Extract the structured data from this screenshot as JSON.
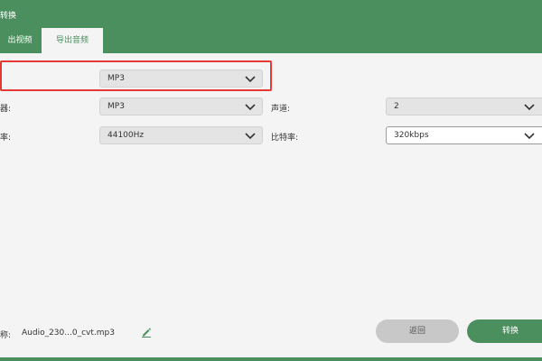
{
  "window": {
    "title": "转换"
  },
  "tabs": {
    "video_label": "出视频",
    "audio_label": "导出音频"
  },
  "settings": {
    "format": {
      "label": ":",
      "value": "MP3"
    },
    "encoder": {
      "label": "器:",
      "value": "MP3"
    },
    "channels": {
      "label": "声道:",
      "value": "2"
    },
    "sample_rate": {
      "label": "率:",
      "value": "44100Hz"
    },
    "bitrate": {
      "label": "比特率:",
      "value": "320kbps"
    }
  },
  "footer": {
    "name_label": "称:",
    "filename": "Audio_230...0_cvt.mp3",
    "back_label": "返回",
    "convert_label": "转换"
  },
  "colors": {
    "accent": "#4c8f5f",
    "highlight": "#e53935"
  },
  "icons": {
    "dropdown": "chevron-down-icon",
    "edit": "pencil-icon"
  }
}
